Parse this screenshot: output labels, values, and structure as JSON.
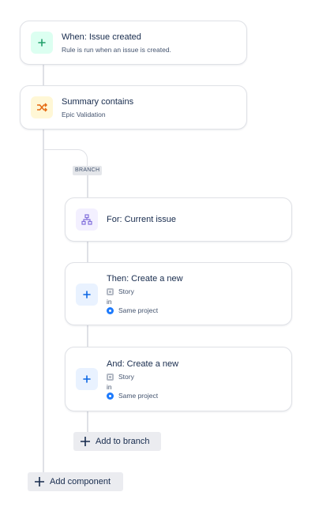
{
  "colors": {
    "trigger_icon_bg": "#dcfff1",
    "trigger_icon_fg": "#22a06b",
    "condition_icon_bg": "#fff7d6",
    "condition_icon_fg": "#e56910",
    "branch_icon_bg": "#f3f0ff",
    "branch_icon_fg": "#8270db",
    "action_icon_bg": "#e9f2ff",
    "action_icon_fg": "#0c66e4",
    "connector": "#dfe1e6"
  },
  "trigger": {
    "title": "When: Issue created",
    "subtitle": "Rule is run when an issue is created.",
    "icon": "plus-icon"
  },
  "condition": {
    "title": "Summary contains",
    "subtitle": "Epic Validation",
    "icon": "shuffle-icon"
  },
  "branch": {
    "badge": "BRANCH",
    "for": {
      "title": "For: Current issue",
      "icon": "hierarchy-icon"
    },
    "actions": [
      {
        "title": "Then: Create a new",
        "issue_type": "Story",
        "in_label": "in",
        "project": "Same project",
        "icon": "plus-icon"
      },
      {
        "title": "And: Create a new",
        "issue_type": "Story",
        "in_label": "in",
        "project": "Same project",
        "icon": "plus-icon"
      }
    ],
    "add_button": "Add to branch"
  },
  "add_component_button": "Add component"
}
